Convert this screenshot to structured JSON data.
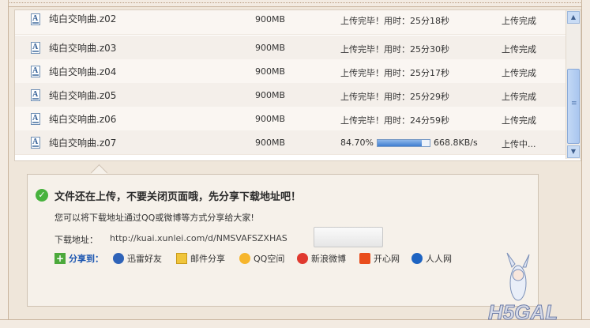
{
  "files": [
    {
      "name": "纯白交响曲.z02",
      "size": "900MB",
      "status": "上传完毕！用时：25分18秒",
      "state": "上传完成"
    },
    {
      "name": "纯白交响曲.z03",
      "size": "900MB",
      "status": "上传完毕！用时：25分30秒",
      "state": "上传完成"
    },
    {
      "name": "纯白交响曲.z04",
      "size": "900MB",
      "status": "上传完毕！用时：25分17秒",
      "state": "上传完成"
    },
    {
      "name": "纯白交响曲.z05",
      "size": "900MB",
      "status": "上传完毕！用时：25分29秒",
      "state": "上传完成"
    },
    {
      "name": "纯白交响曲.z06",
      "size": "900MB",
      "status": "上传完毕！用时：24分59秒",
      "state": "上传完成"
    }
  ],
  "current": {
    "name": "纯白交响曲.z07",
    "size": "900MB",
    "percent": "84.70%",
    "progress": 0.847,
    "speed": "668.8KB/s",
    "state": "上传中..."
  },
  "notice": {
    "headline": "文件还在上传，不要关闭页面哦，先分享下载地址吧！",
    "subline": "您可以将下载地址通过QQ或微博等方式分享给大家!",
    "addr_label": "下载地址：",
    "addr_value": "http://kuai.xunlei.com/d/NMSVAFSZXHAS",
    "copy_label": ""
  },
  "share": {
    "label": "分享到：",
    "items": [
      {
        "label": "迅雷好友",
        "icon": "xunlei-friends-icon"
      },
      {
        "label": "邮件分享",
        "icon": "mail-icon"
      },
      {
        "label": "QQ空间",
        "icon": "qzone-icon"
      },
      {
        "label": "新浪微博",
        "icon": "weibo-icon"
      },
      {
        "label": "开心网",
        "icon": "kaixin-icon"
      },
      {
        "label": "人人网",
        "icon": "renren-icon"
      }
    ]
  },
  "watermark": "H5GAL"
}
